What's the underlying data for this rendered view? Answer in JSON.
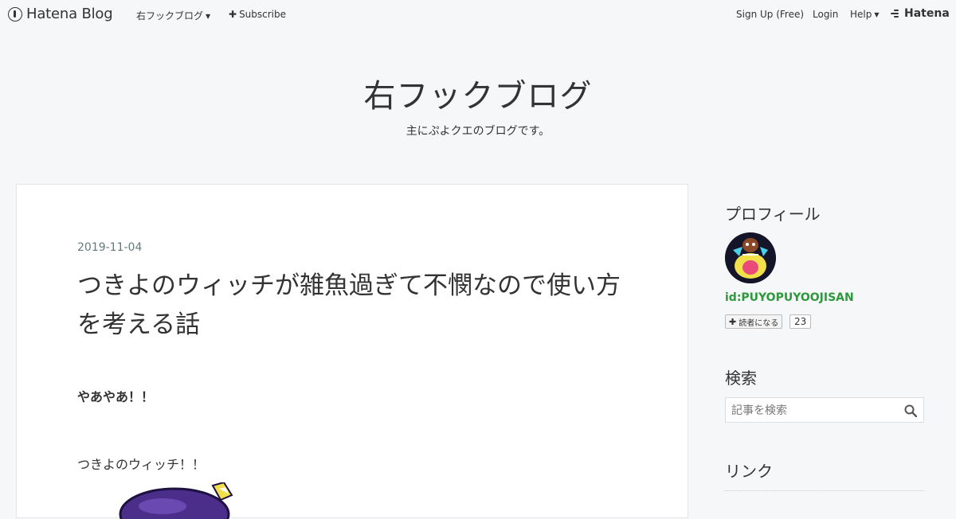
{
  "topbar": {
    "brand": "Hatena Blog",
    "blog_menu": "右フックブログ",
    "subscribe": "Subscribe",
    "signup": "Sign Up (Free)",
    "login": "Login",
    "help": "Help",
    "hatena": "Hatena"
  },
  "header": {
    "title": "右フックブログ",
    "description": "主にぷよクエのブログです。"
  },
  "entry": {
    "date": "2019-11-04",
    "title": "つきよのウィッチが雑魚過ぎて不憫なので使い方を考える話",
    "bold_line": "やあやあ！！",
    "paragraph": "つきよのウィッチ！！"
  },
  "sidebar": {
    "profile_heading": "プロフィール",
    "user_id": "id:PUYOPUYOOJISAN",
    "subscribe_label": "読者になる",
    "subscriber_count": "23",
    "search_heading": "検索",
    "search_placeholder": "記事を検索",
    "links_heading": "リンク"
  },
  "colors": {
    "background": "#f6f7f9",
    "card": "#ffffff",
    "date": "#647a7a",
    "user_id": "#2a9a3a"
  }
}
